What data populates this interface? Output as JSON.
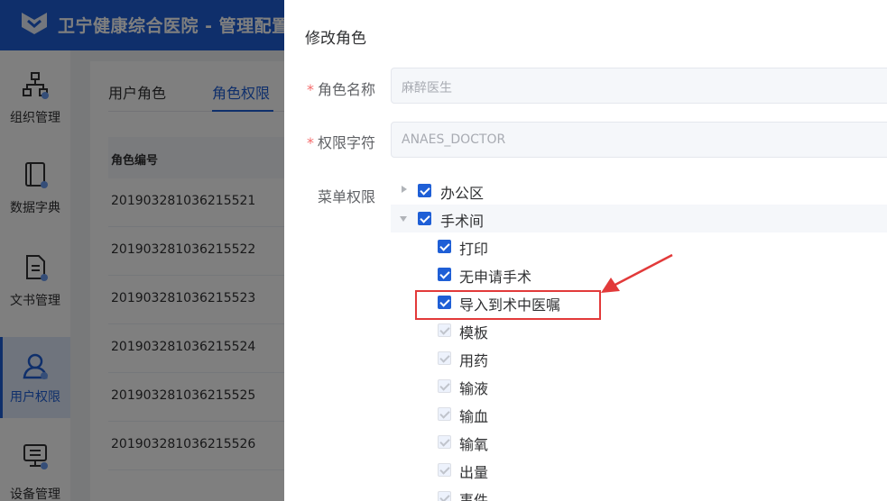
{
  "header": {
    "title": "卫宁健康综合医院 - 管理配置"
  },
  "sidebar": {
    "items": [
      {
        "label": "组织管理",
        "icon": "org-structure-icon"
      },
      {
        "label": "数据字典",
        "icon": "book-icon"
      },
      {
        "label": "文书管理",
        "icon": "document-icon"
      },
      {
        "label": "用户权限",
        "icon": "user-icon",
        "active": true
      },
      {
        "label": "设备管理",
        "icon": "monitor-icon"
      }
    ]
  },
  "main": {
    "tabs": [
      {
        "label": "用户角色"
      },
      {
        "label": "角色权限",
        "active": true
      }
    ],
    "table": {
      "column": "角色编号",
      "rows": [
        "201903281036215521",
        "201903281036215522",
        "201903281036215523",
        "201903281036215524",
        "201903281036215525",
        "201903281036215526"
      ]
    }
  },
  "drawer": {
    "title": "修改角色",
    "role_name": {
      "label": "角色名称",
      "placeholder": "麻醉医生"
    },
    "permission_code": {
      "label": "权限字符",
      "placeholder": "ANAES_DOCTOR"
    },
    "menu_permissions": {
      "label": "菜单权限",
      "tree": [
        {
          "label": "办公区",
          "level": 0,
          "expanded": false,
          "checked": true
        },
        {
          "label": "手术间",
          "level": 0,
          "expanded": true,
          "checked": true
        },
        {
          "label": "打印",
          "level": 1,
          "checked": true
        },
        {
          "label": "无申请手术",
          "level": 1,
          "checked": true
        },
        {
          "label": "导入到术中医嘱",
          "level": 1,
          "checked": true
        },
        {
          "label": "模板",
          "level": 1,
          "checked": true,
          "disabled": true
        },
        {
          "label": "用药",
          "level": 1,
          "checked": true,
          "disabled": true
        },
        {
          "label": "输液",
          "level": 1,
          "checked": true,
          "disabled": true
        },
        {
          "label": "输血",
          "level": 1,
          "checked": true,
          "disabled": true
        },
        {
          "label": "输氧",
          "level": 1,
          "checked": true,
          "disabled": true
        },
        {
          "label": "出量",
          "level": 1,
          "checked": true,
          "disabled": true
        },
        {
          "label": "事件",
          "level": 1,
          "checked": true,
          "disabled": true
        }
      ]
    }
  },
  "colors": {
    "primary": "#1f5fd6",
    "annotation": "#e23a3a"
  }
}
